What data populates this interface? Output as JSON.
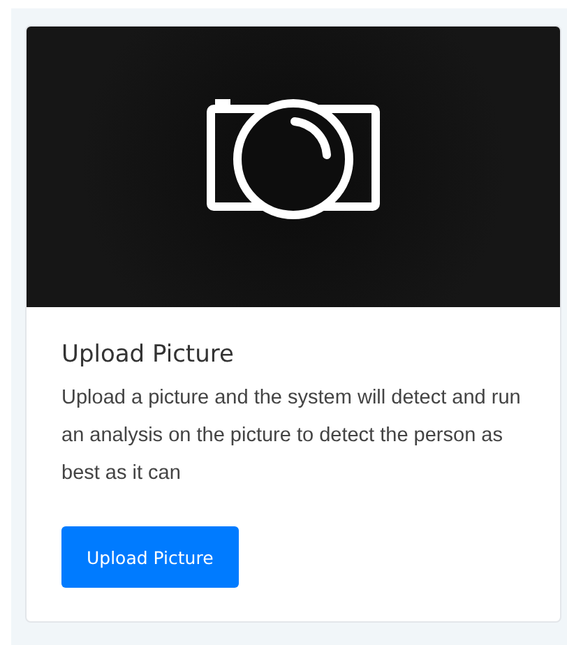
{
  "card": {
    "title": "Upload Picture",
    "description": "Upload a picture and the system will detect and run an analysis on the picture to detect the person as best as it can",
    "button": "Upload Picture"
  }
}
